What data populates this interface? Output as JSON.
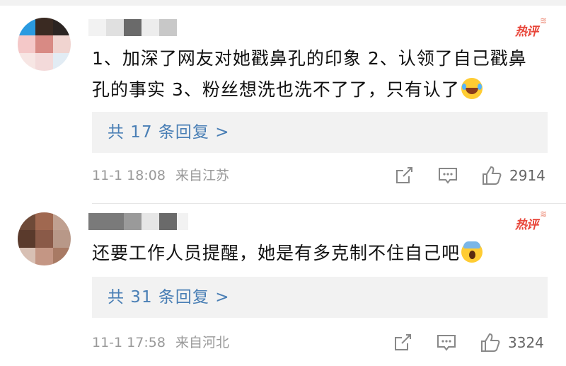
{
  "comments": [
    {
      "badge": "热评",
      "text": "1、加深了网友对她戳鼻孔的印象 2、认领了自己戳鼻孔的事实 3、粉丝想洗也洗不了了，只有认了",
      "emoji": "face-with-tears-of-joy",
      "reply_label": "共 17 条回复 >",
      "time": "11-1 18:08",
      "location": "来自江苏",
      "likes": "2914"
    },
    {
      "badge": "热评",
      "text": "还要工作人员提醒，她是有多克制不住自己吧",
      "emoji": "face-screaming-in-fear",
      "reply_label": "共 31 条回复 >",
      "time": "11-1 17:58",
      "location": "来自河北",
      "likes": "3324"
    }
  ],
  "icons": {
    "share": "share-icon",
    "comment": "comment-icon",
    "like": "thumbs-up-icon"
  },
  "colors": {
    "accent_link": "#4a7fb5",
    "hot_badge": "#e8463a",
    "meta_text": "#999999",
    "reply_bg": "#f2f2f2"
  }
}
